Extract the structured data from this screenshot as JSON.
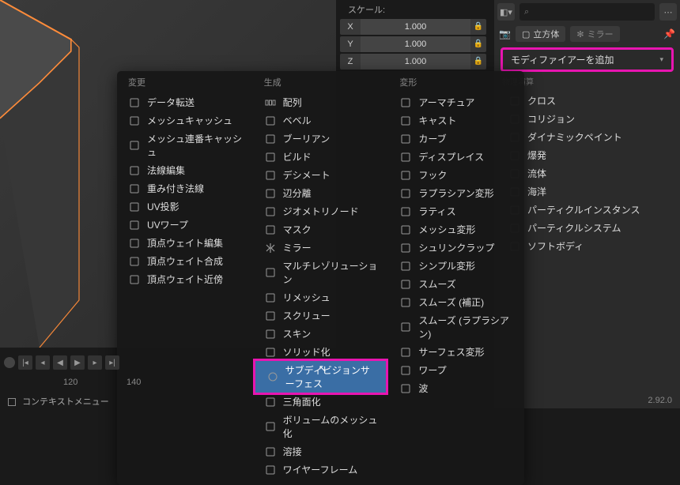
{
  "viewport": {},
  "scale": {
    "label": "スケール:",
    "rows": [
      {
        "axis": "X",
        "val": "1.000"
      },
      {
        "axis": "Y",
        "val": "1.000"
      },
      {
        "axis": "Z",
        "val": "1.000"
      }
    ]
  },
  "props": {
    "search_placeholder": "",
    "object_name": "立方体",
    "modifier_name": "ミラー",
    "add_modifier": "モディファイアーを追加",
    "physics_label": "物理演算"
  },
  "timeline": {
    "nums": [
      "120",
      "140"
    ]
  },
  "context_menu": "コンテキストメニュー",
  "version": "2.92.0",
  "menu": {
    "cols": [
      {
        "header": "変更",
        "items": [
          {
            "icon": "transfer",
            "label": "データ転送"
          },
          {
            "icon": "cache",
            "label": "メッシュキャッシュ"
          },
          {
            "icon": "seqcache",
            "label": "メッシュ連番キャッシュ"
          },
          {
            "icon": "normal",
            "label": "法線編集"
          },
          {
            "icon": "weighted",
            "label": "重み付き法線"
          },
          {
            "icon": "uvproj",
            "label": "UV投影"
          },
          {
            "icon": "uvwarp",
            "label": "UVワープ"
          },
          {
            "icon": "vwedit",
            "label": "頂点ウェイト編集"
          },
          {
            "icon": "vwmix",
            "label": "頂点ウェイト合成"
          },
          {
            "icon": "vwprox",
            "label": "頂点ウェイト近傍"
          }
        ]
      },
      {
        "header": "生成",
        "items": [
          {
            "icon": "array",
            "label": "配列"
          },
          {
            "icon": "bevel",
            "label": "ベベル"
          },
          {
            "icon": "boolean",
            "label": "ブーリアン"
          },
          {
            "icon": "build",
            "label": "ビルド"
          },
          {
            "icon": "decimate",
            "label": "デシメート"
          },
          {
            "icon": "edgesplit",
            "label": "辺分離"
          },
          {
            "icon": "geonodes",
            "label": "ジオメトリノード"
          },
          {
            "icon": "mask",
            "label": "マスク"
          },
          {
            "icon": "mirror",
            "label": "ミラー"
          },
          {
            "icon": "multires",
            "label": "マルチレゾリューション"
          },
          {
            "icon": "remesh",
            "label": "リメッシュ"
          },
          {
            "icon": "screw",
            "label": "スクリュー"
          },
          {
            "icon": "skin",
            "label": "スキン"
          },
          {
            "icon": "solidify",
            "label": "ソリッド化"
          },
          {
            "icon": "subsurf",
            "label": "サブディビジョンサーフェス",
            "highlight": true,
            "cursor": true
          },
          {
            "icon": "tri",
            "label": "三角面化"
          },
          {
            "icon": "voxel",
            "label": "ボリュームのメッシュ化"
          },
          {
            "icon": "weld",
            "label": "溶接"
          },
          {
            "icon": "wire",
            "label": "ワイヤーフレーム"
          }
        ]
      },
      {
        "header": "変形",
        "items": [
          {
            "icon": "armature",
            "label": "アーマチュア"
          },
          {
            "icon": "cast",
            "label": "キャスト"
          },
          {
            "icon": "curve",
            "label": "カーブ"
          },
          {
            "icon": "displace",
            "label": "ディスプレイス"
          },
          {
            "icon": "hook",
            "label": "フック"
          },
          {
            "icon": "laplace",
            "label": "ラプラシアン変形"
          },
          {
            "icon": "lattice",
            "label": "ラティス"
          },
          {
            "icon": "meshdef",
            "label": "メッシュ変形"
          },
          {
            "icon": "shrink",
            "label": "シュリンクラップ"
          },
          {
            "icon": "simple",
            "label": "シンプル変形"
          },
          {
            "icon": "smooth",
            "label": "スムーズ"
          },
          {
            "icon": "smoothc",
            "label": "スムーズ (補正)"
          },
          {
            "icon": "smoothl",
            "label": "スムーズ (ラプラシアン)"
          },
          {
            "icon": "surfdef",
            "label": "サーフェス変形"
          },
          {
            "icon": "warp",
            "label": "ワープ"
          },
          {
            "icon": "wave",
            "label": "波"
          }
        ]
      }
    ]
  },
  "phys_col": {
    "items": [
      {
        "icon": "cloth",
        "label": "クロス"
      },
      {
        "icon": "collision",
        "label": "コリジョン"
      },
      {
        "icon": "dynpaint",
        "label": "ダイナミックペイント"
      },
      {
        "icon": "explode",
        "label": "爆発"
      },
      {
        "icon": "fluid",
        "label": "流体"
      },
      {
        "icon": "ocean",
        "label": "海洋"
      },
      {
        "icon": "pinst",
        "label": "パーティクルインスタンス"
      },
      {
        "icon": "psys",
        "label": "パーティクルシステム"
      },
      {
        "icon": "softbody",
        "label": "ソフトボディ"
      }
    ]
  }
}
